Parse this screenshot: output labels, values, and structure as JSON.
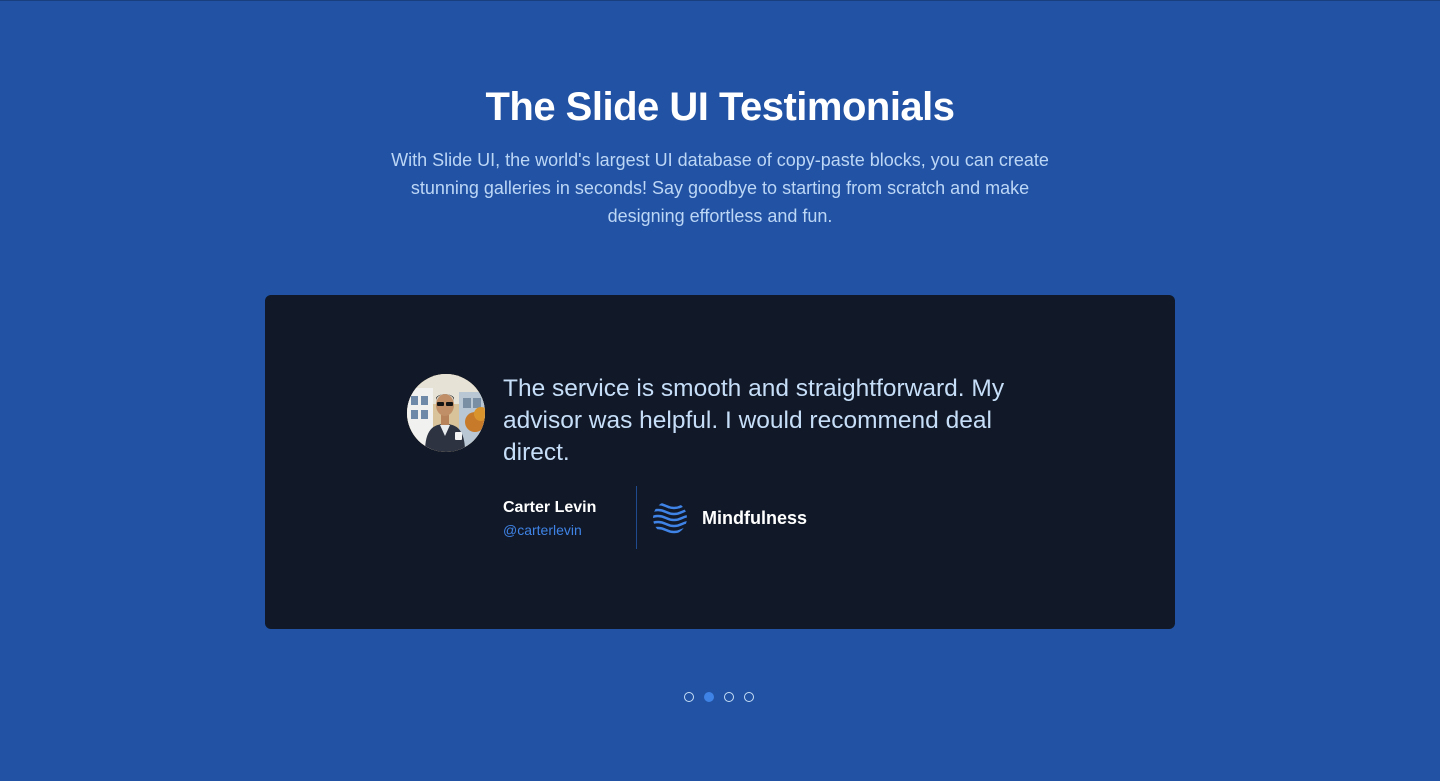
{
  "section": {
    "title": "The Slide UI Testimonials",
    "description": "With Slide UI, the world's largest UI database of copy-paste blocks, you can create stunning galleries in seconds! Say goodbye to starting from scratch and make designing effortless and fun."
  },
  "testimonial": {
    "quote": "The service is smooth and straightforward. My advisor was helpful. I would recommend deal direct.",
    "author_name": "Carter Levin",
    "author_handle": "@carterlevin",
    "avatar_icon": "person-photo",
    "company_name": "Mindfulness",
    "company_logo_icon": "waves-logo-icon"
  },
  "pagination": {
    "count": 4,
    "active_index": 1
  },
  "colors": {
    "background": "#2152a3",
    "card": "#111827",
    "accent": "#3f83e6",
    "quote_text": "#c6def8"
  }
}
